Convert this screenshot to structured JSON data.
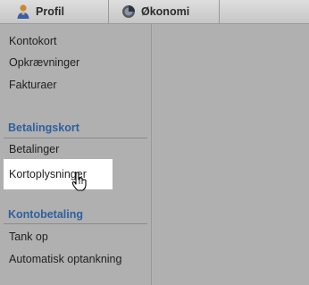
{
  "tabs": [
    {
      "label": "Profil",
      "icon": "user-icon"
    },
    {
      "label": "Økonomi",
      "icon": "economy-icon"
    }
  ],
  "sidebar": {
    "items_top": [
      {
        "label": "Kontokort"
      },
      {
        "label": "Opkrævninger"
      },
      {
        "label": "Fakturaer"
      }
    ],
    "sections": [
      {
        "title": "Betalingskort",
        "items": [
          {
            "label": "Betalinger"
          },
          {
            "label": "Kortoplysninger",
            "highlighted": true
          }
        ]
      },
      {
        "title": "Kontobetaling",
        "items": [
          {
            "label": "Tank op"
          },
          {
            "label": "Automatisk optankning"
          }
        ]
      }
    ]
  },
  "colors": {
    "section_title": "#2f5f9f",
    "background": "#b3b3b3",
    "highlight": "#ffffff"
  }
}
